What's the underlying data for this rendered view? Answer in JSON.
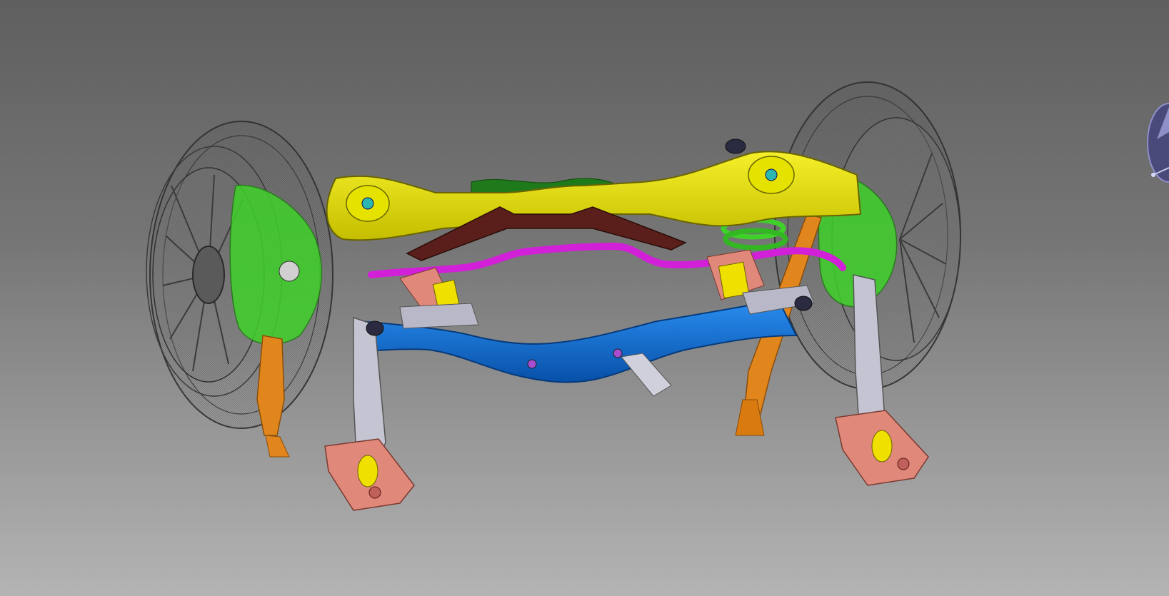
{
  "viewer": {
    "background_top": "#5f5f5f",
    "background_bottom": "#b4b4b4"
  },
  "assembly": {
    "parts": [
      {
        "id": "tire-left",
        "color": "#3a3a3a",
        "icon": "wireframe-tire"
      },
      {
        "id": "tire-right",
        "color": "#3a3a3a",
        "icon": "wireframe-tire"
      },
      {
        "id": "upper-crossmember",
        "color": "#e5e000"
      },
      {
        "id": "rear-subframe",
        "color": "#0a63c8"
      },
      {
        "id": "stabilizer-bar",
        "color": "#d21fd8"
      },
      {
        "id": "center-bracket",
        "color": "#5a1f1a"
      },
      {
        "id": "knuckle",
        "color": "#3fd12a"
      },
      {
        "id": "shock-absorber",
        "color": "#e0861c"
      },
      {
        "id": "trailing-arm",
        "color": "#b8b8c8"
      },
      {
        "id": "spring-seat",
        "color": "#e0887a"
      }
    ]
  },
  "compass": {
    "icon": "compass-icon",
    "color": "#8f8fc9"
  }
}
